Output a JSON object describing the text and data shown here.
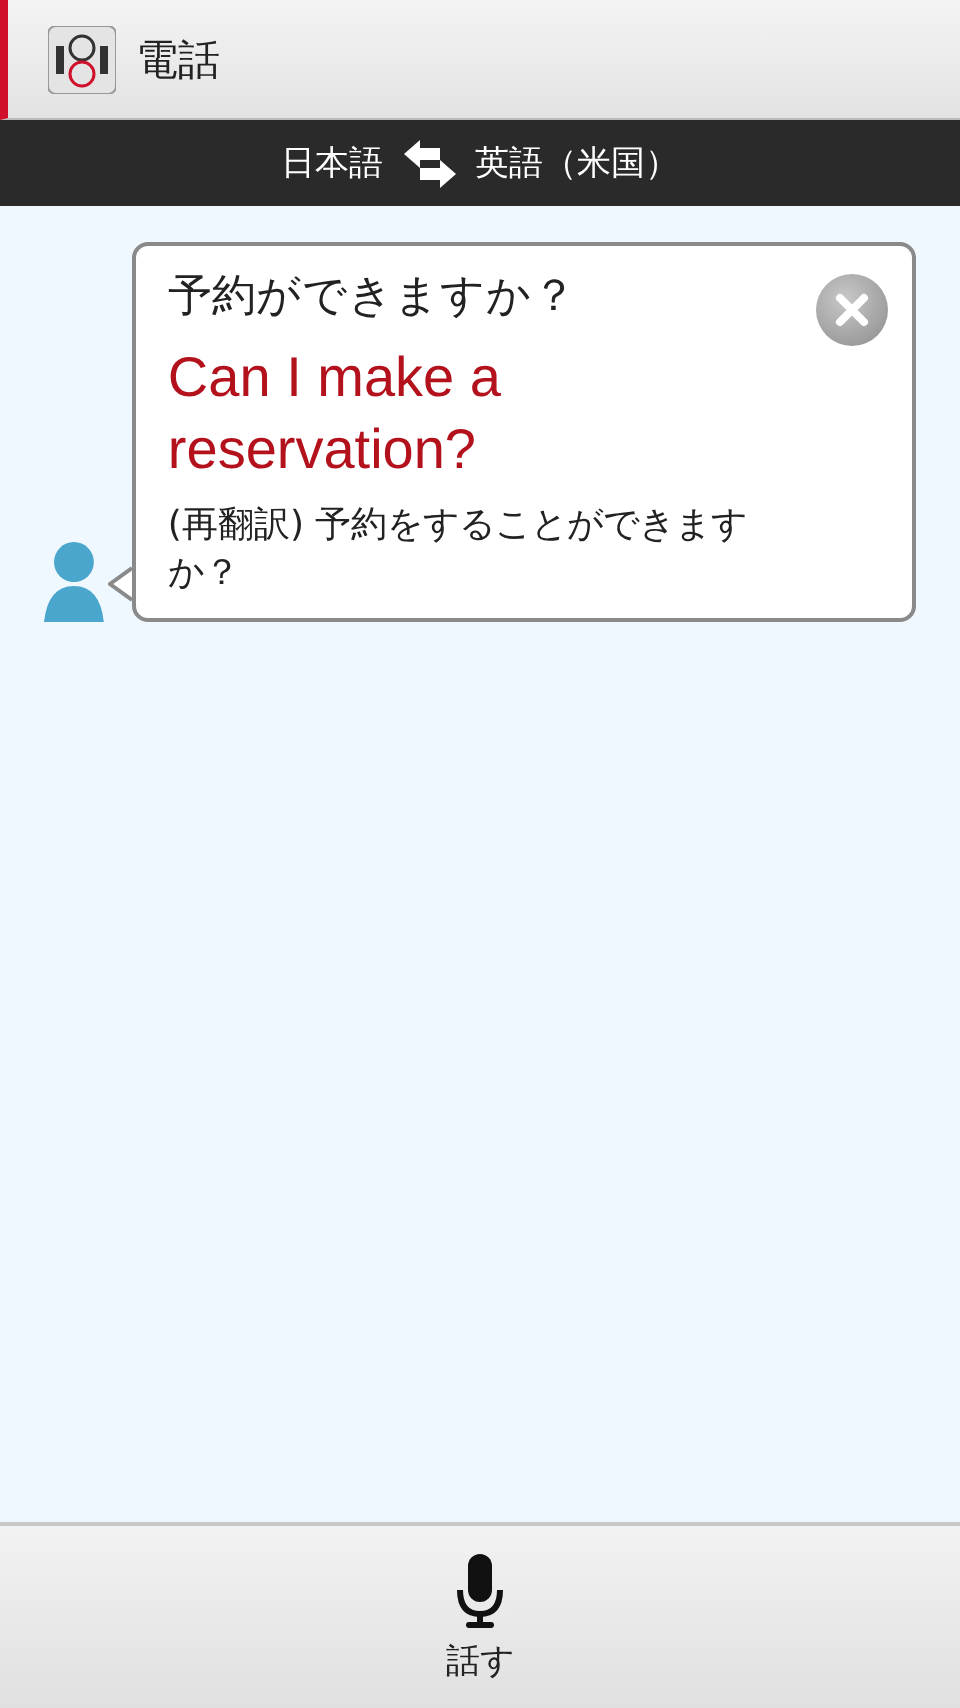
{
  "app_bar": {
    "title": "電話"
  },
  "language_bar": {
    "source": "日本語",
    "target": "英語（米国）"
  },
  "messages": [
    {
      "source_text": "予約ができますか？",
      "translation": "Can I make a reservation?",
      "back_translation": "(再翻訳) 予約をすることができますか？"
    }
  ],
  "speak_button": {
    "label": "話す"
  }
}
